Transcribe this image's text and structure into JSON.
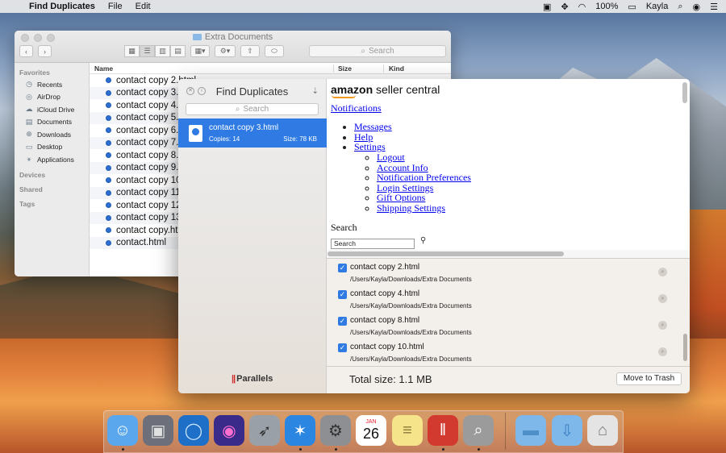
{
  "menubar": {
    "app_name": "Find Duplicates",
    "menus": [
      "File",
      "Edit"
    ],
    "battery": "100%",
    "user": "Kayla"
  },
  "finder": {
    "title": "Extra Documents",
    "search_placeholder": "Search",
    "sidebar": {
      "favorites_label": "Favorites",
      "items": [
        "Recents",
        "AirDrop",
        "iCloud Drive",
        "Documents",
        "Downloads",
        "Desktop",
        "Applications"
      ],
      "devices_label": "Devices",
      "shared_label": "Shared",
      "tags_label": "Tags"
    },
    "columns": {
      "name": "Name",
      "size": "Size",
      "kind": "Kind"
    },
    "files": [
      "contact copy 2.html",
      "contact copy 3.",
      "contact copy 4.",
      "contact copy 5.",
      "contact copy 6.",
      "contact copy 7.",
      "contact copy 8.",
      "contact copy 9.",
      "contact copy 10",
      "contact copy 11",
      "contact copy 12",
      "contact copy 13",
      "contact copy.ht",
      "contact.html"
    ]
  },
  "find_duplicates": {
    "title": "Find Duplicates",
    "search_placeholder": "Search",
    "selected_group": {
      "name": "contact copy 3.html",
      "copies": "Copies: 14",
      "size": "Size: 78 KB"
    },
    "brand": "Parallels",
    "preview": {
      "logo_main": "amazon",
      "logo_sub": "seller central",
      "notifications": "Notifications",
      "menu": [
        "Messages",
        "Help",
        "Settings"
      ],
      "settings_submenu": [
        "Logout",
        "Account Info",
        "Notification Preferences",
        "Login Settings",
        "Gift Options",
        "Shipping Settings"
      ],
      "search_heading": "Search",
      "search_value": "Search"
    },
    "duplicates": [
      {
        "name": "contact copy 2.html",
        "path": "/Users/Kayla/Downloads/Extra Documents",
        "checked": true
      },
      {
        "name": "contact copy 4.html",
        "path": "/Users/Kayla/Downloads/Extra Documents",
        "checked": true
      },
      {
        "name": "contact copy 8.html",
        "path": "/Users/Kayla/Downloads/Extra Documents",
        "checked": true
      },
      {
        "name": "contact copy 10.html",
        "path": "/Users/Kayla/Downloads/Extra Documents",
        "checked": true
      }
    ],
    "total_size": "Total size: 1.1 MB",
    "move_to_trash": "Move to Trash"
  },
  "dock": {
    "items": [
      "finder-icon",
      "screenshot-icon",
      "quicktime-icon",
      "siri-icon",
      "launchpad-icon",
      "safari-icon",
      "system-preferences-icon",
      "calendar-icon",
      "notes-icon",
      "parallels-icon",
      "find-duplicates-icon",
      "folder-icon",
      "downloads-folder-icon",
      "trash-icon"
    ],
    "calendar_month": "JAN",
    "calendar_day": "26"
  }
}
